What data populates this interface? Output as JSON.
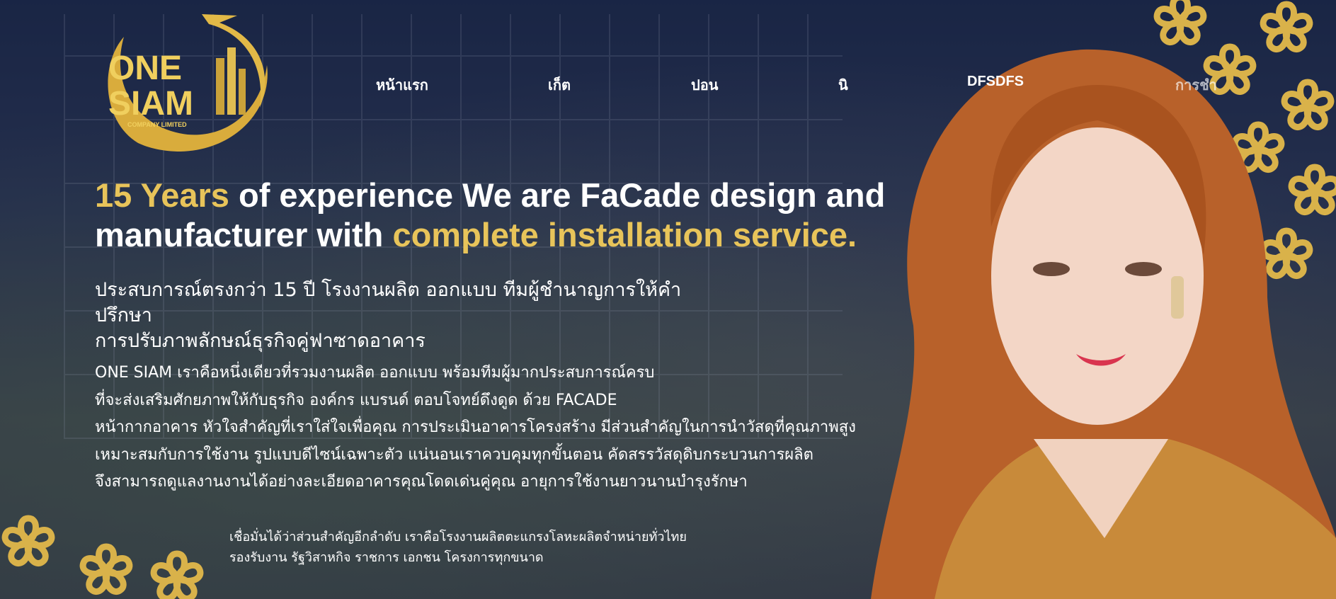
{
  "logo": {
    "line1": "ONE",
    "line2": "SIAM",
    "tagline": "COMPANY LIMITED"
  },
  "nav": {
    "items": [
      {
        "label": "หน้าแรก"
      },
      {
        "label": "เก็ต"
      },
      {
        "label": "ปอน"
      },
      {
        "label": "นิ"
      },
      {
        "label": "DFSDFS"
      },
      {
        "label": "การชำ"
      }
    ]
  },
  "hero": {
    "headline_part1": "15 Years",
    "headline_part2": " of experience We are FaCade design and manufacturer with ",
    "headline_part3": "complete installation service.",
    "subhead_line1": "ประสบการณ์ตรงกว่า 15 ปี โรงงานผลิต ออกแบบ ทีมผู้ชำนาญการให้คำปรึกษา",
    "subhead_line2": "การปรับภาพลักษณ์ธุรกิจคู่ฟาซาดอาคาร",
    "body_lines": [
      "ONE SIAM เราคือหนึ่งเดียวที่รวมงานผลิต ออกแบบ พร้อมทีมผู้มากประสบการณ์ครบ",
      "ที่จะส่งเสริมศักยภาพให้กับธุรกิจ องค์กร แบรนด์ ตอบโจทย์ดึงดูด ด้วย FACADE",
      "หน้ากากอาคาร หัวใจสำคัญที่เราใส่ใจเพื่อคุณ การประเมินอาคารโครงสร้าง มีส่วนสำคัญในการนำวัสดุที่คุณภาพสูง",
      "เหมาะสมกับการใช้งาน รูปแบบดีไซน์เฉพาะตัว แน่นอนเราควบคุมทุกขั้นตอน คัดสรรวัสดุดิบกระบวนการผลิต",
      "จึงสามารถดูแลงานงานได้อย่างละเอียดอาคารคุณโดดเด่นคู่คุณ อายุการใช้งานยาวนานบำรุงรักษา"
    ],
    "small_lines": [
      "เชื่อมั่นได้ว่าส่วนสำคัญอีกลำดับ เราคือโรงงานผลิตตะแกรงโลหะผลิตจำหน่ายทั่วไทย",
      "รองรับงาน รัฐวิสาหกิจ ราชการ เอกชน โครงการทุกขนาด"
    ]
  },
  "colors": {
    "accent_gold": "#e8c45a",
    "text": "#ffffff"
  }
}
